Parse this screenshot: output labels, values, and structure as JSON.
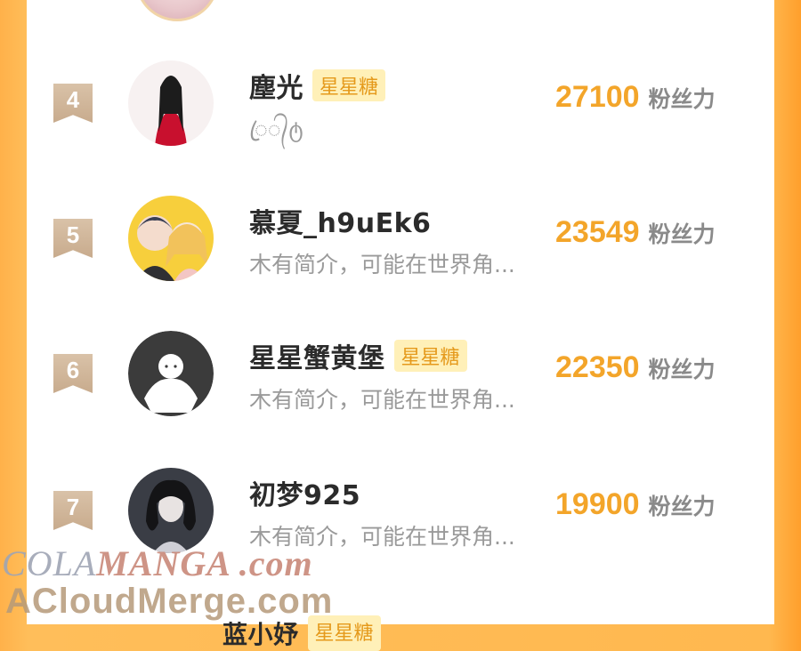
{
  "ranking": [
    {
      "rank": "4",
      "name": "塵光",
      "badge": "星星糖",
      "bio": "ꦿ᭄ტ",
      "score": "27100",
      "unit": "粉丝力"
    },
    {
      "rank": "5",
      "name": "慕夏_h9uEk6",
      "badge": "",
      "bio": "木有简介，可能在世界角...",
      "score": "23549",
      "unit": "粉丝力"
    },
    {
      "rank": "6",
      "name": "星星蟹黄堡",
      "badge": "星星糖",
      "bio": "木有简介，可能在世界角...",
      "score": "22350",
      "unit": "粉丝力"
    },
    {
      "rank": "7",
      "name": "初梦925",
      "badge": "",
      "bio": "木有简介，可能在世界角...",
      "score": "19900",
      "unit": "粉丝力"
    }
  ],
  "next_peek": {
    "name": "蓝小妤",
    "badge": "星星糖"
  },
  "watermark": {
    "line1_a": "COLA",
    "line1_b": "MANGA",
    "line1_c": " .com",
    "line2": "ACloudMerge.com"
  },
  "colors": {
    "accent": "#f3a52a",
    "badge_bg": "#fff0b8",
    "badge_text": "#e59a1c"
  }
}
